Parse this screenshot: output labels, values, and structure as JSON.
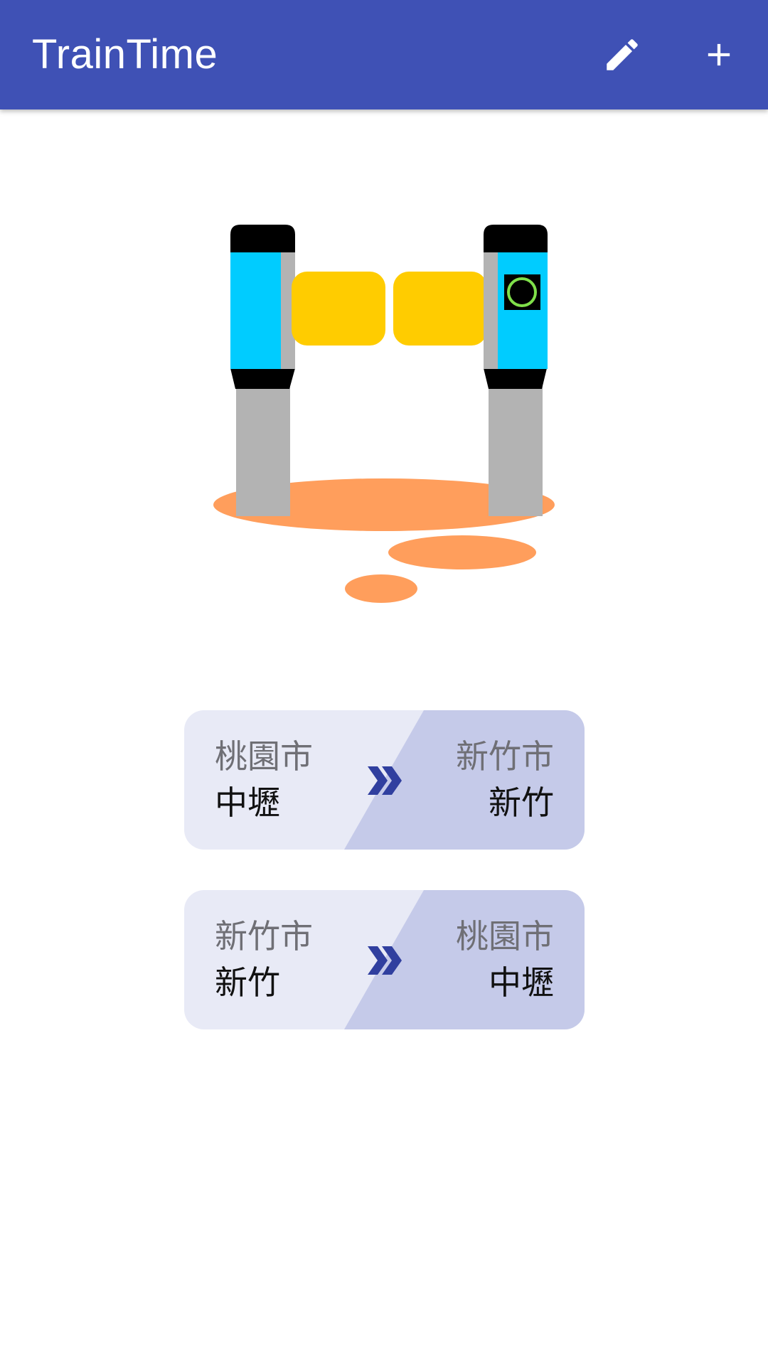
{
  "app": {
    "title": "TrainTime"
  },
  "toolbar": {
    "edit_icon": "pencil-icon",
    "add_icon": "plus-icon"
  },
  "colors": {
    "primary": "#3F51B5",
    "card_light": "#E8EAF6",
    "card_dark": "#C5CAE9",
    "arrow": "#303F9F",
    "gate_blue": "#00CCFF",
    "gate_yellow": "#FFCC00",
    "floor_orange": "#FF9E5C"
  },
  "routes": [
    {
      "from_city": "桃園市",
      "from_station": "中壢",
      "to_city": "新竹市",
      "to_station": "新竹"
    },
    {
      "from_city": "新竹市",
      "from_station": "新竹",
      "to_city": "桃園市",
      "to_station": "中壢"
    }
  ]
}
